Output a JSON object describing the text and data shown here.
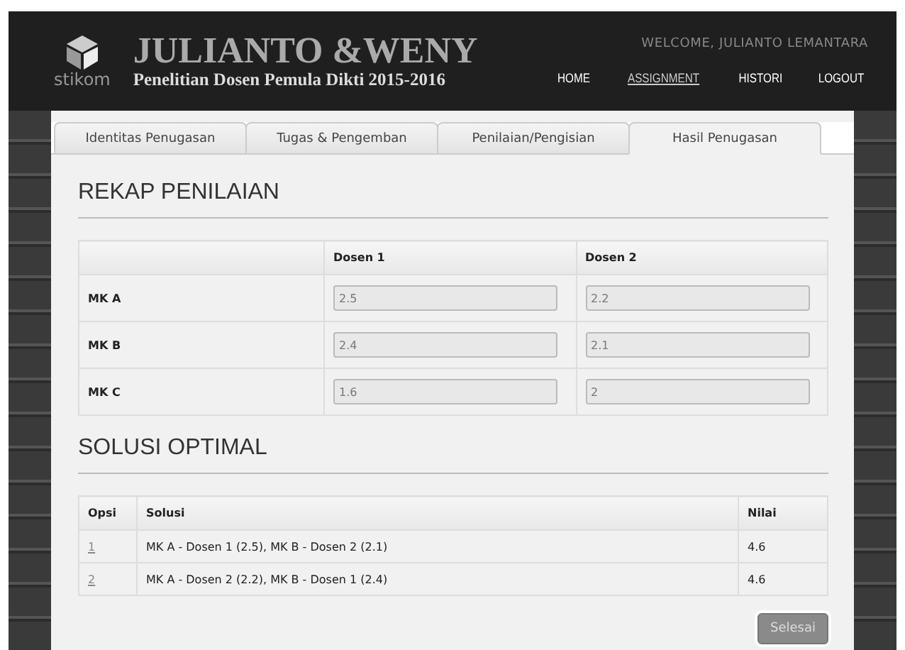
{
  "header": {
    "logo_text": "stikom",
    "title": "JULIANTO &WENY",
    "subtitle": "Penelitian Dosen Pemula Dikti 2015-2016",
    "welcome": "WELCOME, JULIANTO LEMANTARA",
    "nav": [
      {
        "label": "HOME",
        "selected": false
      },
      {
        "label": "ASSIGNMENT",
        "selected": true
      },
      {
        "label": "HISTORI",
        "selected": false
      },
      {
        "label": "LOGOUT",
        "selected": false
      }
    ]
  },
  "tabs": [
    {
      "label": "Identitas Penugasan",
      "selected": false
    },
    {
      "label": "Tugas & Pengemban",
      "selected": false
    },
    {
      "label": "Penilaian/Pengisian",
      "selected": false
    },
    {
      "label": "Hasil Penugasan",
      "selected": true
    }
  ],
  "rekap": {
    "title": "REKAP PENILAIAN",
    "columns": [
      "Dosen 1",
      "Dosen 2"
    ],
    "rows": [
      {
        "label": "MK A",
        "values": [
          "2.5",
          "2.2"
        ]
      },
      {
        "label": "MK B",
        "values": [
          "2.4",
          "2.1"
        ]
      },
      {
        "label": "MK C",
        "values": [
          "1.6",
          "2"
        ]
      }
    ]
  },
  "solusi": {
    "title": "SOLUSI OPTIMAL",
    "columns": [
      "Opsi",
      "Solusi",
      "Nilai"
    ],
    "rows": [
      {
        "opsi": "1",
        "solusi": "MK A - Dosen 1 (2.5), MK B - Dosen 2 (2.1)",
        "nilai": "4.6"
      },
      {
        "opsi": "2",
        "solusi": "MK A - Dosen 2 (2.2), MK B - Dosen 1 (2.4)",
        "nilai": "4.6"
      }
    ]
  },
  "finish_button": "Selesai"
}
